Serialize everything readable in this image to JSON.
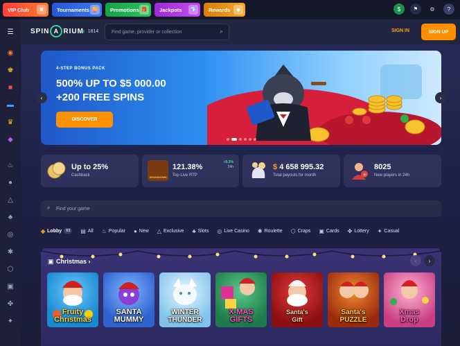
{
  "promo_bar": {
    "items": [
      {
        "label": "VIP Club",
        "bg": "#ff4d3a",
        "icon": "crown-icon"
      },
      {
        "label": "Tournaments",
        "bg": "#2e5fe0",
        "count": "4",
        "icon": "trophy-icon"
      },
      {
        "label": "Promotions",
        "bg": "#1fae4a",
        "icon": "gift-icon"
      },
      {
        "label": "Jackpots",
        "bg": "#a934e0",
        "icon": "gem-icon"
      },
      {
        "label": "Rewards",
        "bg": "#e58a12",
        "icon": "chest-icon"
      }
    ],
    "right_icons": [
      "dollar-icon",
      "flag-icon",
      "gear-icon",
      "help-icon"
    ]
  },
  "header": {
    "logo": {
      "part1": "SPIN",
      "part2": "A",
      "part3": "RIUM"
    },
    "online_count": "1814",
    "search_placeholder": "Find game, provider or collection",
    "sign_in": "SIGN IN",
    "sign_up": "SIGN UP"
  },
  "sidebar": {
    "icons": [
      "menu-collapse-icon",
      "spin-wheel-icon",
      "trophy-icon",
      "gift-icon",
      "ticket-icon",
      "crown-icon",
      "gem-icon",
      "fire-icon",
      "chat-icon",
      "pyramid-icon",
      "cherries-icon",
      "live-icon",
      "roulette-icon",
      "dice-icon",
      "cards-icon",
      "clover-icon",
      "lottery-icon"
    ]
  },
  "banner": {
    "eyebrow": "4-STEP BONUS PACK",
    "title_line1": "500% UP TO $5 000.00",
    "title_line2": "+200 FREE SPINS",
    "cta": "DISCOVER",
    "slides": 6,
    "active_slide": 1
  },
  "stats": [
    {
      "value": "Up to 25%",
      "label": "Cashback",
      "icon": "coins-icon"
    },
    {
      "value": "121.38%",
      "label": "Top Live RTP",
      "delta": "+9.3%",
      "delta_period": "24h",
      "icon": "game-thumb-icon",
      "thumb_text": "SHOWDOWN"
    },
    {
      "currency": "$",
      "value": "4 658 995.32",
      "label": "Total payouts for month",
      "icon": "payout-bag-icon"
    },
    {
      "value": "8025",
      "label": "New players in 24h",
      "icon": "new-player-icon"
    }
  ],
  "game_search": {
    "placeholder": "Find your game"
  },
  "categories": [
    {
      "label": "Lobby",
      "count": "93",
      "icon": "lobby-icon",
      "active": true
    },
    {
      "label": "All",
      "icon": "all-icon"
    },
    {
      "label": "Popular",
      "icon": "fire-icon"
    },
    {
      "label": "New",
      "icon": "new-icon"
    },
    {
      "label": "Exclusive",
      "icon": "exclusive-icon"
    },
    {
      "label": "Slots",
      "icon": "slots-icon"
    },
    {
      "label": "Live Casino",
      "icon": "live-icon"
    },
    {
      "label": "Roulette",
      "icon": "roulette-icon"
    },
    {
      "label": "Craps",
      "icon": "dice-icon"
    },
    {
      "label": "Cards",
      "icon": "cards-icon"
    },
    {
      "label": "Lottery",
      "icon": "lottery-icon"
    },
    {
      "label": "Casual",
      "icon": "casual-icon"
    }
  ],
  "christmas": {
    "title": "Christmas",
    "games": [
      {
        "name_line1": "Fruity",
        "name_line2": "Christmas",
        "bg": "#1a8ad0",
        "color": "#ffd23f"
      },
      {
        "name_line1": "SANTA",
        "name_line2": "MUMMY",
        "bg": "#2f7be0",
        "color": "#ffffff"
      },
      {
        "name_line1": "WINTER",
        "name_line2": "THUNDER",
        "bg": "#9fd7f5",
        "color": "#ffffff"
      },
      {
        "name_line1": "X-MAS",
        "name_line2": "GIFTS",
        "bg": "#2aa060",
        "color": "#ff4fc0"
      },
      {
        "name_line1": "Santa's",
        "name_line2": "Gift",
        "bg": "#b11a1a",
        "color": "#ffd6a0"
      },
      {
        "name_line1": "Santa's",
        "name_line2": "PUZZLE",
        "bg": "#c83c1a",
        "color": "#ffd23f"
      },
      {
        "name_line1": "Xmas",
        "name_line2": "Drop",
        "bg": "#d04a8a",
        "color": "#ff5fb5"
      }
    ]
  },
  "colors": {
    "accent_orange": "#ff8f00",
    "green": "#34d399"
  }
}
